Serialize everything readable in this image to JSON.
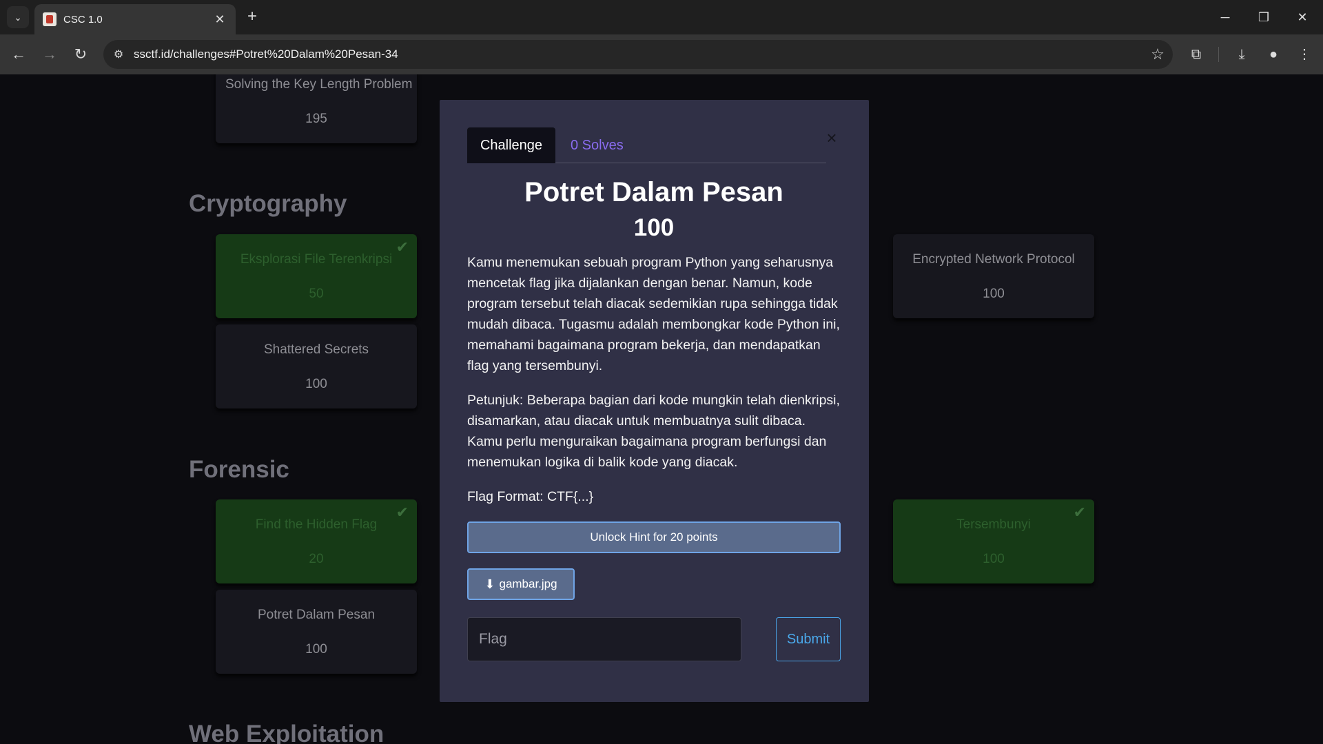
{
  "browser": {
    "tab_title": "CSC 1.0",
    "url": "ssctf.id/challenges#Potret%20Dalam%20Pesan-34"
  },
  "categories": [
    {
      "name": "Cryptography"
    },
    {
      "name": "Forensic"
    },
    {
      "name": "Web Exploitation"
    }
  ],
  "cards": [
    {
      "name": "Solving the Key Length Problem",
      "points": "195",
      "solved": false
    },
    {
      "name": "Eksplorasi File Terenkripsi",
      "points": "50",
      "solved": true
    },
    {
      "name": "Shattered Secrets",
      "points": "100",
      "solved": false
    },
    {
      "name": "Encrypted Network Protocol",
      "points": "100",
      "solved": false
    },
    {
      "name": "Find the Hidden Flag",
      "points": "20",
      "solved": true
    },
    {
      "name": "Potret Dalam Pesan",
      "points": "100",
      "solved": false
    },
    {
      "name": "Tersembunyi",
      "points": "100",
      "solved": true
    }
  ],
  "modal": {
    "tab_challenge": "Challenge",
    "tab_solves": "0 Solves",
    "close": "×",
    "title": "Potret Dalam Pesan",
    "points": "100",
    "description": [
      "Kamu menemukan sebuah program Python yang seharusnya mencetak flag jika dijalankan dengan benar. Namun, kode program tersebut telah diacak sedemikian rupa sehingga tidak mudah dibaca. Tugasmu adalah membongkar kode Python ini, memahami bagaimana program bekerja, dan mendapatkan flag yang tersembunyi.",
      "Petunjuk: Beberapa bagian dari kode mungkin telah dienkripsi, disamarkan, atau diacak untuk membuatnya sulit dibaca. Kamu perlu menguraikan bagaimana program berfungsi dan menemukan logika di balik kode yang diacak.",
      "Flag Format: CTF{...}"
    ],
    "hint_button": "Unlock Hint for 20 points",
    "file_button": "gambar.jpg",
    "flag_placeholder": "Flag",
    "flag_value": "",
    "submit_label": "Submit"
  }
}
